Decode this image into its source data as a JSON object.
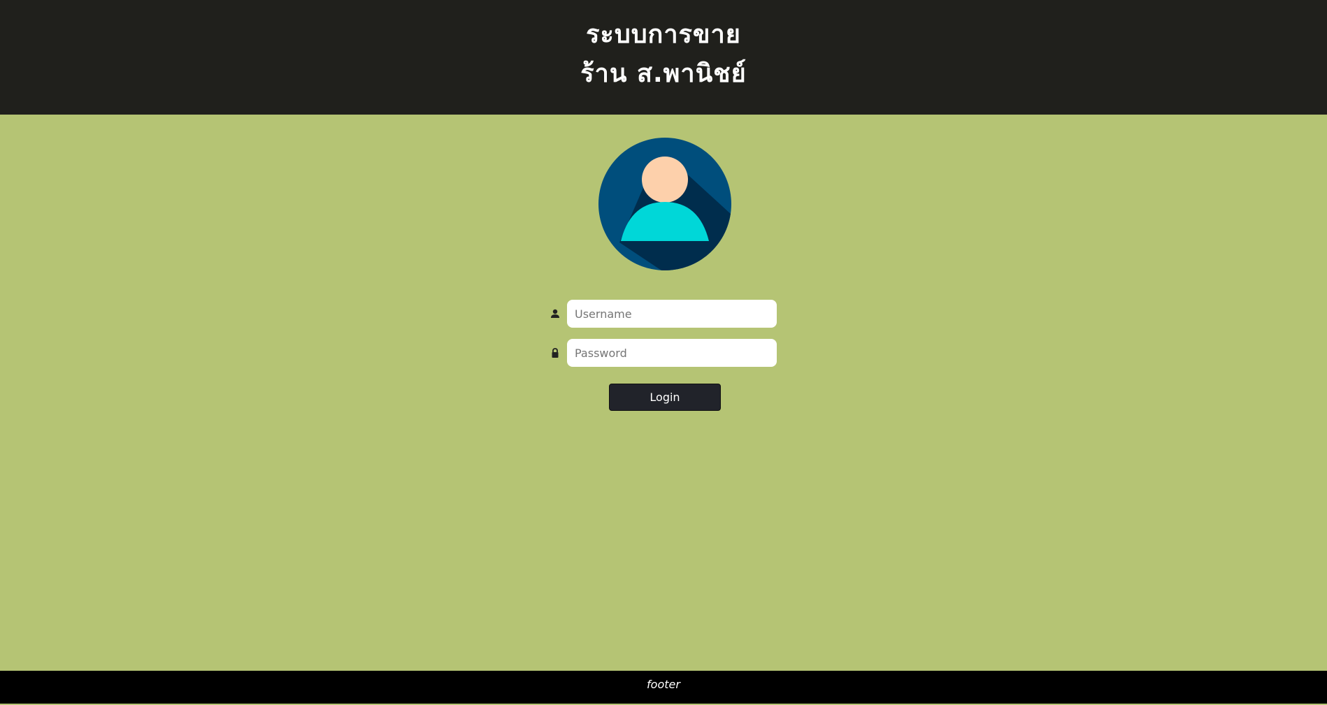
{
  "header": {
    "title_line1": "ระบบการขาย",
    "title_line2": "ร้าน ส.พานิชย์"
  },
  "login": {
    "username_placeholder": "Username",
    "username_value": "",
    "password_placeholder": "Password",
    "password_value": "",
    "login_label": "Login",
    "avatar_icon": "user-avatar-icon",
    "username_icon": "person-icon",
    "password_icon": "lock-icon"
  },
  "footer": {
    "text": "footer"
  },
  "colors": {
    "header_bg": "#20201c",
    "page_bg": "#b5c474",
    "button_bg": "#21232a",
    "footer_bg": "#000000"
  }
}
